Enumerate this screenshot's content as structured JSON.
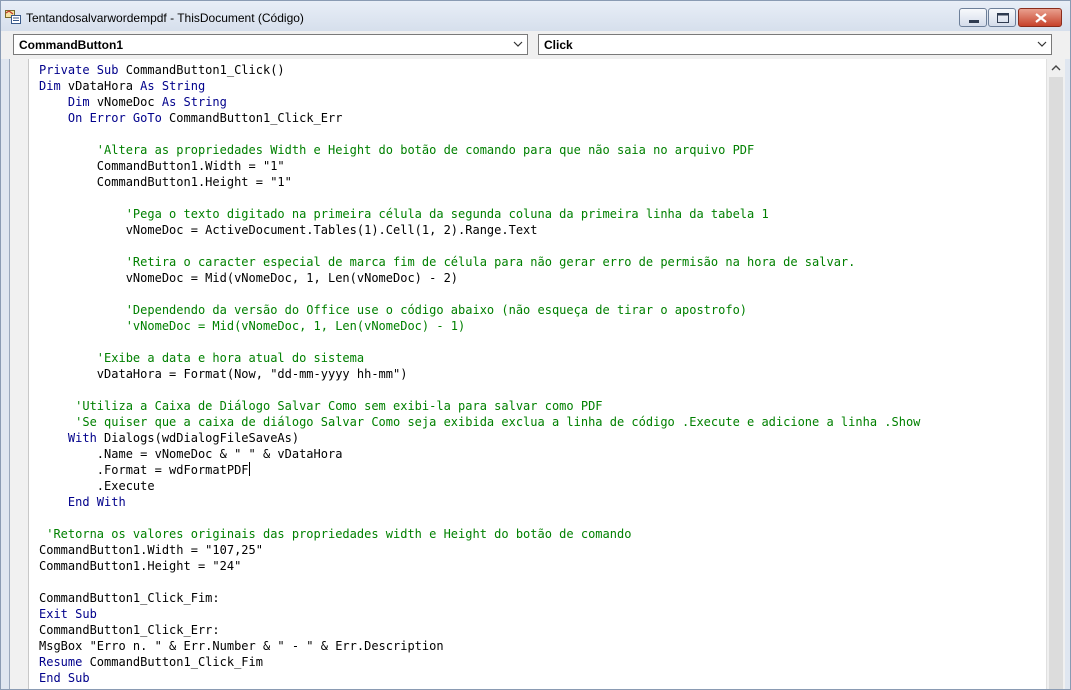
{
  "window": {
    "title": "Tentandosalvarwordempdf - ThisDocument (Código)"
  },
  "icons": {
    "app": "vba-project-icon",
    "minimize": "minimize-icon",
    "maximize": "maximize-icon",
    "close": "close-icon",
    "dropdown": "chevron-down-icon",
    "scroll_up": "scroll-up-arrow-icon"
  },
  "colors": {
    "keyword": "#00008b",
    "comment": "#008000",
    "text": "#000000",
    "close_button": "#c7432b"
  },
  "object_combo": {
    "value": "CommandButton1"
  },
  "procedure_combo": {
    "value": "Click"
  },
  "code": {
    "lines": [
      [
        {
          "k": "kw",
          "t": "Private Sub"
        },
        {
          "k": "tx",
          "t": " CommandButton1_Click()"
        }
      ],
      [
        {
          "k": "kw",
          "t": "Dim"
        },
        {
          "k": "tx",
          "t": " vDataHora "
        },
        {
          "k": "kw",
          "t": "As String"
        }
      ],
      [
        {
          "k": "tx",
          "t": "    "
        },
        {
          "k": "kw",
          "t": "Dim"
        },
        {
          "k": "tx",
          "t": " vNomeDoc "
        },
        {
          "k": "kw",
          "t": "As String"
        }
      ],
      [
        {
          "k": "tx",
          "t": "    "
        },
        {
          "k": "kw",
          "t": "On Error GoTo"
        },
        {
          "k": "tx",
          "t": " CommandButton1_Click_Err"
        }
      ],
      [],
      [
        {
          "k": "cm",
          "t": "        'Altera as propriedades Width e Height do botão de comando para que não saia no arquivo PDF"
        }
      ],
      [
        {
          "k": "tx",
          "t": "        CommandButton1.Width = \"1\""
        }
      ],
      [
        {
          "k": "tx",
          "t": "        CommandButton1.Height = \"1\""
        }
      ],
      [],
      [
        {
          "k": "cm",
          "t": "            'Pega o texto digitado na primeira célula da segunda coluna da primeira linha da tabela 1"
        }
      ],
      [
        {
          "k": "tx",
          "t": "            vNomeDoc = ActiveDocument.Tables(1).Cell(1, 2).Range.Text"
        }
      ],
      [],
      [
        {
          "k": "cm",
          "t": "            'Retira o caracter especial de marca fim de célula para não gerar erro de permisão na hora de salvar."
        }
      ],
      [
        {
          "k": "tx",
          "t": "            vNomeDoc = Mid(vNomeDoc, 1, Len(vNomeDoc) - 2)"
        }
      ],
      [],
      [
        {
          "k": "cm",
          "t": "            'Dependendo da versão do Office use o código abaixo (não esqueça de tirar o apostrofo)"
        }
      ],
      [
        {
          "k": "cm",
          "t": "            'vNomeDoc = Mid(vNomeDoc, 1, Len(vNomeDoc) - 1)"
        }
      ],
      [],
      [
        {
          "k": "cm",
          "t": "        'Exibe a data e hora atual do sistema"
        }
      ],
      [
        {
          "k": "tx",
          "t": "        vDataHora = Format(Now, \"dd-mm-yyyy hh-mm\")"
        }
      ],
      [],
      [
        {
          "k": "cm",
          "t": "     'Utiliza a Caixa de Diálogo Salvar Como sem exibi-la para salvar como PDF"
        }
      ],
      [
        {
          "k": "cm",
          "t": "     'Se quiser que a caixa de diálogo Salvar Como seja exibida exclua a linha de código .Execute e adicione a linha .Show"
        }
      ],
      [
        {
          "k": "tx",
          "t": "    "
        },
        {
          "k": "kw",
          "t": "With"
        },
        {
          "k": "tx",
          "t": " Dialogs(wdDialogFileSaveAs)"
        }
      ],
      [
        {
          "k": "tx",
          "t": "        .Name = vNomeDoc & \" \" & vDataHora"
        }
      ],
      [
        {
          "k": "tx",
          "t": "        .Format = wdFormatPDF"
        },
        {
          "k": "caret",
          "t": ""
        }
      ],
      [
        {
          "k": "tx",
          "t": "        .Execute"
        }
      ],
      [
        {
          "k": "tx",
          "t": "    "
        },
        {
          "k": "kw",
          "t": "End With"
        }
      ],
      [],
      [
        {
          "k": "cm",
          "t": " 'Retorna os valores originais das propriedades width e Height do botão de comando"
        }
      ],
      [
        {
          "k": "tx",
          "t": "CommandButton1.Width = \"107,25\""
        }
      ],
      [
        {
          "k": "tx",
          "t": "CommandButton1.Height = \"24\""
        }
      ],
      [],
      [
        {
          "k": "tx",
          "t": "CommandButton1_Click_Fim:"
        }
      ],
      [
        {
          "k": "kw",
          "t": "Exit Sub"
        }
      ],
      [
        {
          "k": "tx",
          "t": "CommandButton1_Click_Err:"
        }
      ],
      [
        {
          "k": "tx",
          "t": "MsgBox \"Erro n. \" & Err.Number & \" - \" & Err.Description"
        }
      ],
      [
        {
          "k": "kw",
          "t": "Resume"
        },
        {
          "k": "tx",
          "t": " CommandButton1_Click_Fim"
        }
      ],
      [
        {
          "k": "kw",
          "t": "End Sub"
        }
      ]
    ]
  }
}
